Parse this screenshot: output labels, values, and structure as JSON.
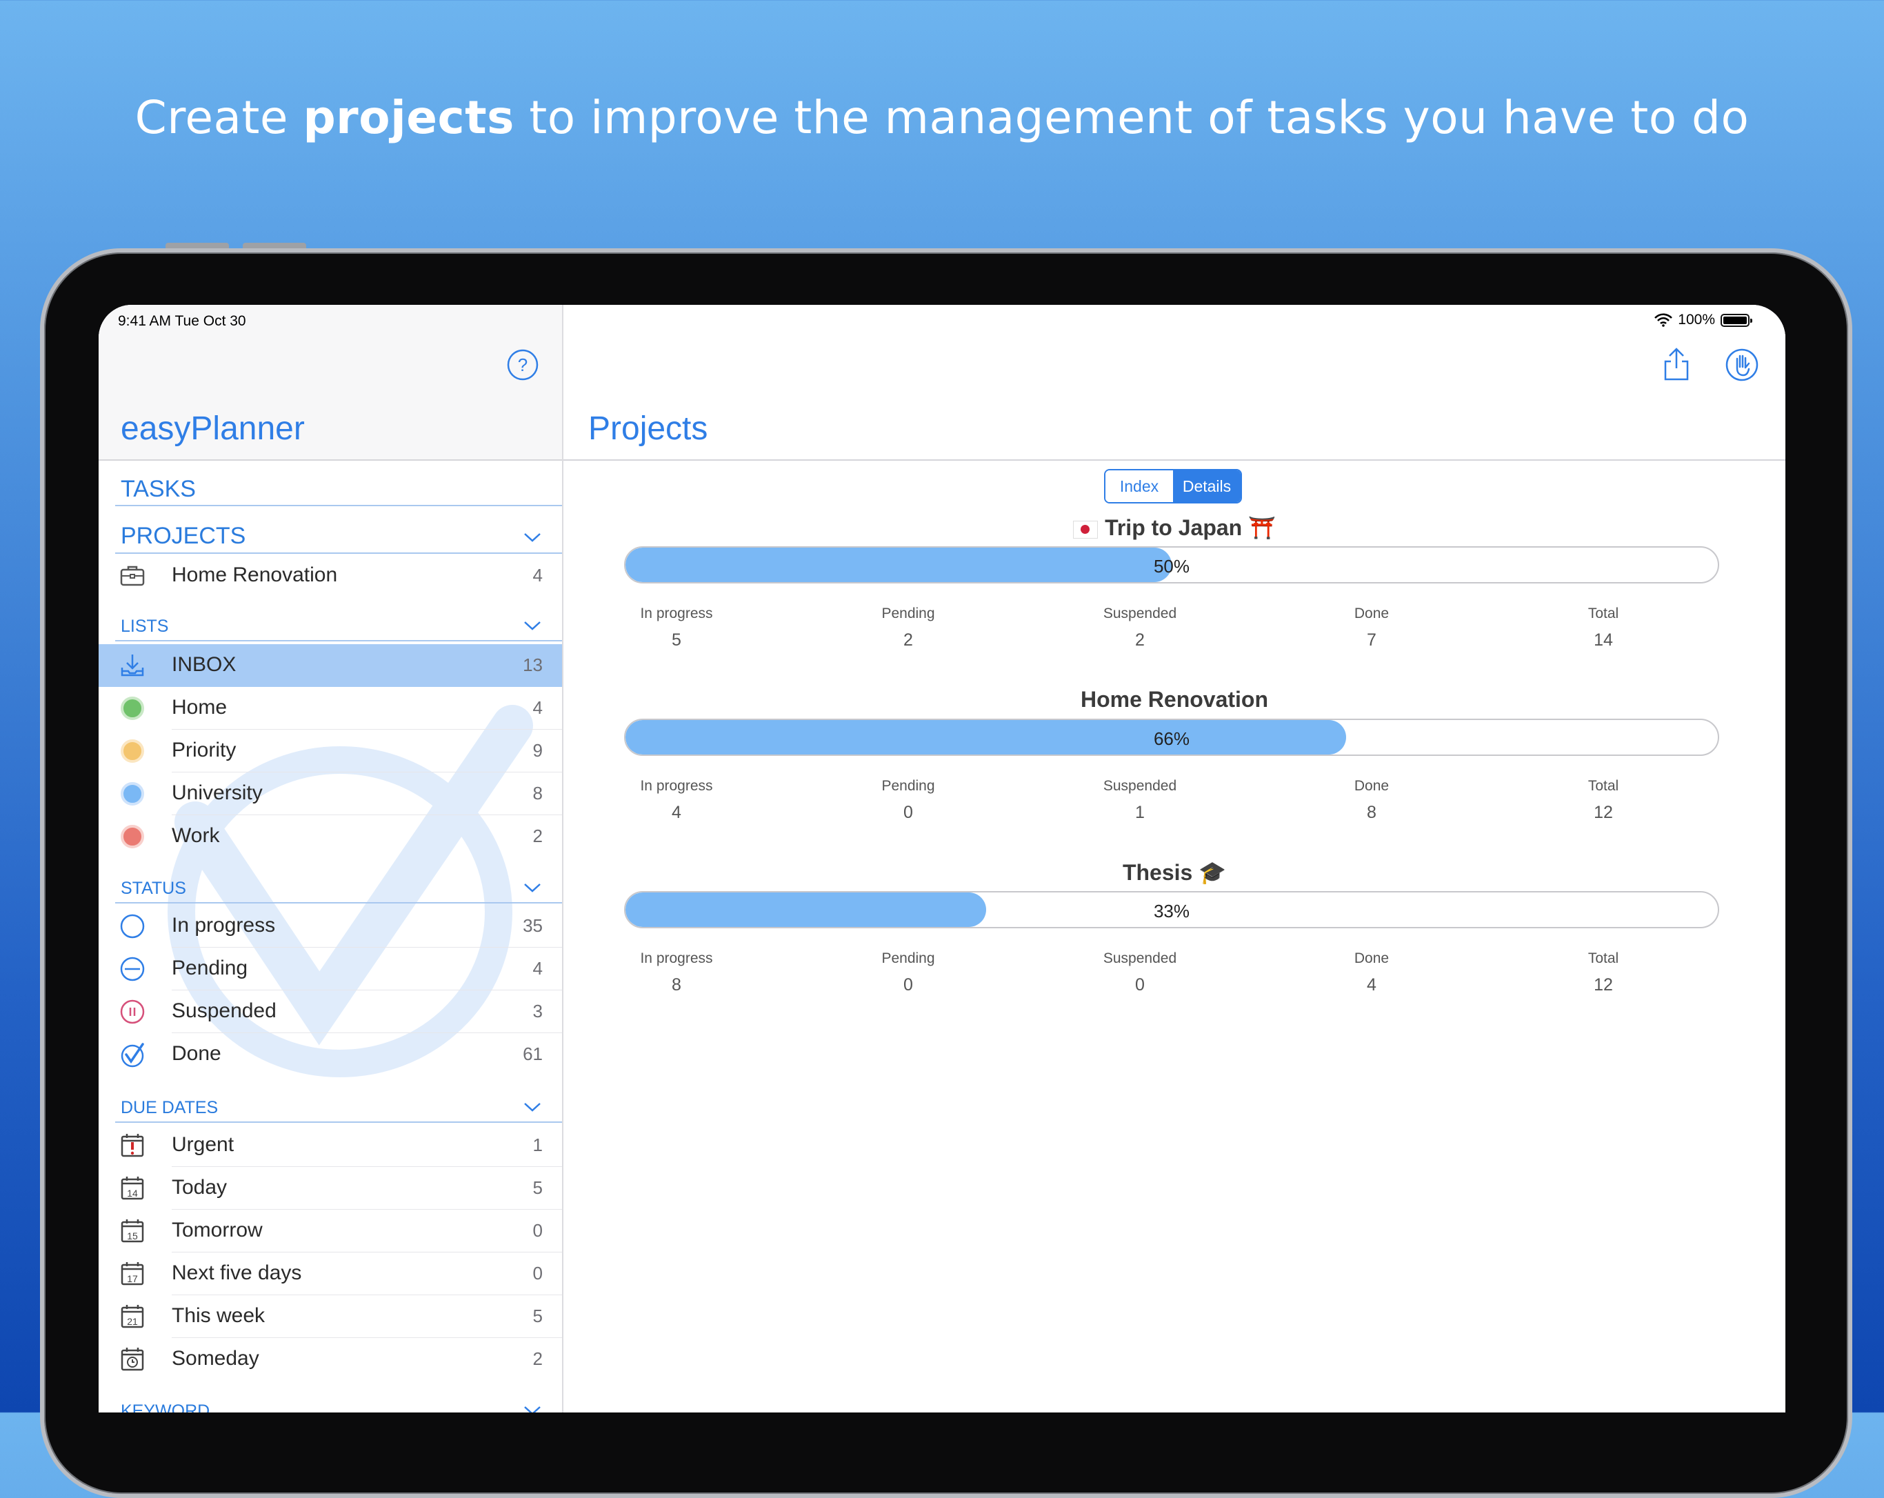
{
  "headline": {
    "before": "Create ",
    "bold": "projects",
    "after": " to improve the management of tasks you have to do"
  },
  "statusbar": {
    "time": "9:41 AM  Tue Oct 30",
    "battery": "100%"
  },
  "sidebar": {
    "title": "easyPlanner",
    "tasks_label": "TASKS",
    "projects": {
      "title": "PROJECTS",
      "items": [
        {
          "label": "Home Renovation",
          "count": "4"
        }
      ]
    },
    "lists": {
      "title": "LISTS",
      "items": [
        {
          "label": "INBOX",
          "count": "13",
          "selected": true
        },
        {
          "label": "Home",
          "count": "4",
          "color": "#6fc16a"
        },
        {
          "label": "Priority",
          "count": "9",
          "color": "#f4c56e"
        },
        {
          "label": "University",
          "count": "8",
          "color": "#7ab8f5"
        },
        {
          "label": "Work",
          "count": "2",
          "color": "#ea7a72"
        }
      ]
    },
    "status": {
      "title": "STATUS",
      "items": [
        {
          "label": "In progress",
          "count": "35"
        },
        {
          "label": "Pending",
          "count": "4"
        },
        {
          "label": "Suspended",
          "count": "3"
        },
        {
          "label": "Done",
          "count": "61"
        }
      ]
    },
    "due_dates": {
      "title": "DUE DATES",
      "items": [
        {
          "label": "Urgent",
          "count": "1"
        },
        {
          "label": "Today",
          "count": "5",
          "day": "14"
        },
        {
          "label": "Tomorrow",
          "count": "0",
          "day": "15"
        },
        {
          "label": "Next five days",
          "count": "0",
          "day": "17"
        },
        {
          "label": "This week",
          "count": "5",
          "day": "21"
        },
        {
          "label": "Someday",
          "count": "2"
        }
      ]
    },
    "keyword_title": "KEYWORD"
  },
  "main": {
    "title": "Projects",
    "segments": {
      "index": "Index",
      "details": "Details",
      "selected": "details"
    },
    "stat_labels": {
      "in_progress": "In progress",
      "pending": "Pending",
      "suspended": "Suspended",
      "done": "Done",
      "total": "Total"
    },
    "projects": [
      {
        "name": "Trip to Japan ⛩️",
        "percent": 50,
        "percent_label": "50%",
        "in_progress": "5",
        "pending": "2",
        "suspended": "2",
        "done": "7",
        "total": "14"
      },
      {
        "name": "Home Renovation",
        "percent": 66,
        "percent_label": "66%",
        "in_progress": "4",
        "pending": "0",
        "suspended": "1",
        "done": "8",
        "total": "12"
      },
      {
        "name": "Thesis 🎓",
        "percent": 33,
        "percent_label": "33%",
        "in_progress": "8",
        "pending": "0",
        "suspended": "0",
        "done": "4",
        "total": "12"
      }
    ]
  },
  "colors": {
    "accent": "#2f7ee6",
    "progress_fill": "#7ab8f5",
    "selected_row": "#a7cbf5"
  }
}
